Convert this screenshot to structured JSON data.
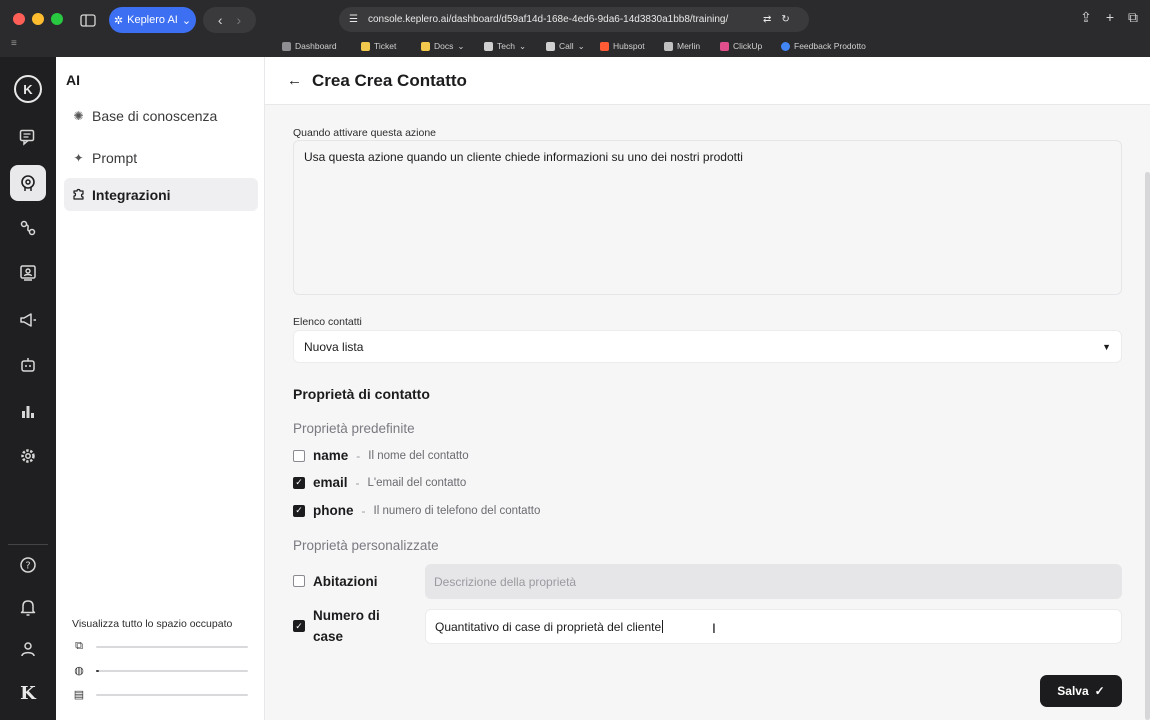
{
  "browser": {
    "profile_label": "Keplero AI",
    "url": "console.keplero.ai/dashboard/d59af14d-168e-4ed6-9da6-14d3830a1bb8/training/",
    "bookmarks": [
      {
        "label": "Dashboard",
        "color": "#8e8e93"
      },
      {
        "label": "Ticket",
        "color": "#f2c94c"
      },
      {
        "label": "Docs",
        "color": "#f2c94c"
      },
      {
        "label": "Tech",
        "color": "#d0d0d0"
      },
      {
        "label": "Call",
        "color": "#d0d0d0"
      },
      {
        "label": "Hubspot",
        "color": "#ff5c35"
      },
      {
        "label": "Merlin",
        "color": "#c0c0c0"
      },
      {
        "label": "ClickUp",
        "color": "#e04e8c"
      },
      {
        "label": "Feedback Prodotto",
        "color": "#4285f4"
      }
    ]
  },
  "sidebar": {
    "title": "AI",
    "items": [
      {
        "label": "Base di conoscenza",
        "icon": "brain-icon"
      },
      {
        "label": "Prompt",
        "icon": "sparkle-icon"
      },
      {
        "label": "Integrazioni",
        "icon": "puzzle-icon"
      }
    ],
    "storage": {
      "title": "Visualizza tutto lo spazio occupato",
      "bars": [
        {
          "icon": "copy-icon",
          "fraction": 0.0
        },
        {
          "icon": "globe-icon",
          "fraction": 0.02
        },
        {
          "icon": "file-icon",
          "fraction": 0.0
        }
      ]
    }
  },
  "header": {
    "title": "Crea Crea Contatto"
  },
  "form": {
    "trigger_label": "Quando attivare questa azione",
    "trigger_value": "Usa questa azione quando un cliente chiede informazioni su uno dei nostri prodotti",
    "list_label": "Elenco contatti",
    "list_value": "Nuova lista",
    "section_title": "Proprietà di contatto",
    "predefined_title": "Proprietà predefinite",
    "predefined": [
      {
        "name": "name",
        "desc": "Il nome del contatto",
        "checked": false
      },
      {
        "name": "email",
        "desc": "L'email del contatto",
        "checked": true
      },
      {
        "name": "phone",
        "desc": "Il numero di telefono del contatto",
        "checked": true
      }
    ],
    "custom_title": "Proprietà personalizzate",
    "custom": [
      {
        "name": "Abitazioni",
        "placeholder": "Descrizione della proprietà",
        "value": "",
        "checked": false
      },
      {
        "name_line1": "Numero di",
        "name_line2": "case",
        "value": "Quantitativo di case di proprietà del cliente",
        "checked": true
      }
    ],
    "dash": "-",
    "save_label": "Salva"
  }
}
